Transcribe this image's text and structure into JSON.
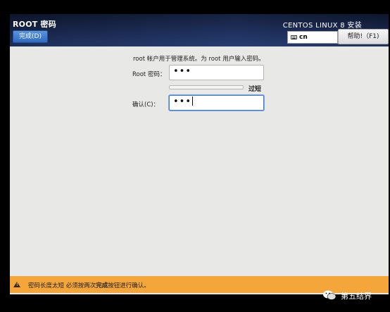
{
  "header": {
    "page_title": "ROOT 密码",
    "done_label": "完成(D)",
    "product_title": "CENTOS LINUX 8 安装",
    "keyboard_layout": "cn",
    "help_label": "帮助!（F1)"
  },
  "form": {
    "intro": "root 帐户用于管理系统。为 root 用户输入密码。",
    "root_password_label": "Root 密码：",
    "root_password_value": "•••",
    "strength_label": "过短",
    "strength_fraction": 0.0,
    "confirm_label": "确认(C)：",
    "confirm_value": "•••"
  },
  "warning": {
    "prefix": "密码长度太短 必须按两次",
    "emphasis": "完成",
    "suffix": "按钮进行确认。"
  },
  "watermark": {
    "text": "第五结界"
  },
  "colors": {
    "header_dark": "#0e1830",
    "accent_button": "#2f6ac0",
    "warning_bar": "#f4a63a",
    "panel_bg": "#e8e8e7"
  }
}
